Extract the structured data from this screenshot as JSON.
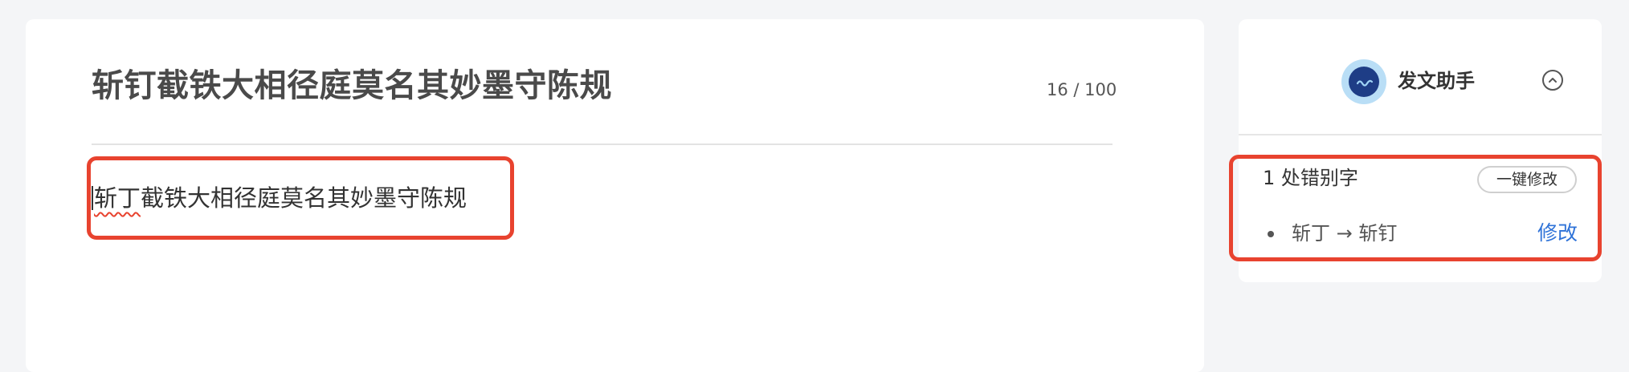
{
  "editor": {
    "title": "斩钉截铁大相径庭莫名其妙墨守陈规",
    "char_count": "16 / 100",
    "body_typo_word": "斩丁",
    "body_rest": "截铁大相径庭莫名其妙墨守陈规"
  },
  "assistant": {
    "title": "发文助手",
    "error_count": "1 处错别字",
    "fix_all_label": "一键修改",
    "suggestion": "斩丁 → 斩钉",
    "fix_label": "修改"
  },
  "colors": {
    "highlight_border": "#e8432f",
    "link": "#2f73d8",
    "avatar_bg": "#b9def6",
    "avatar_inner": "#1e3d86"
  },
  "icons": {
    "avatar": "assistant-avatar-icon",
    "collapse": "chevron-up-circle-icon"
  }
}
